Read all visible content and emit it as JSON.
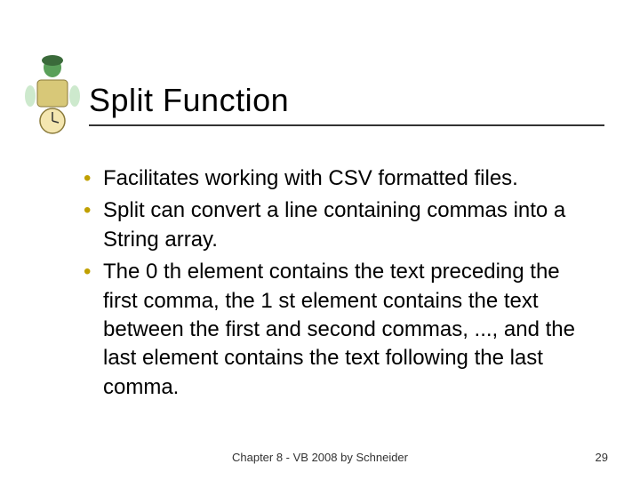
{
  "title": "Split Function",
  "bullets": [
    "Facilitates working with CSV formatted files.",
    "Split can convert a line containing commas into a String array.",
    "The 0 th element contains the text preceding the first comma, the 1 st element contains the text between the first and second commas, ..., and the last element contains the text following the last comma."
  ],
  "footer": "Chapter 8 - VB 2008 by Schneider",
  "page_number": "29"
}
